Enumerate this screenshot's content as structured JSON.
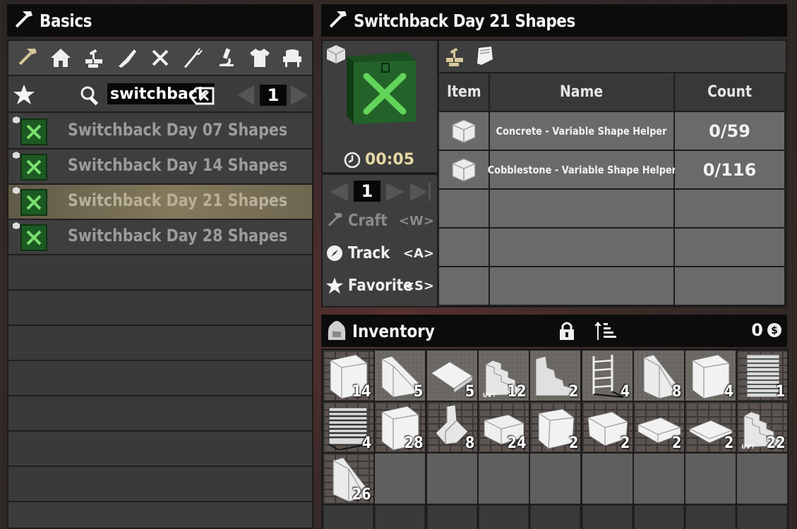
{
  "left_header": {
    "title": "Basics"
  },
  "categories": [
    "hammer-icon",
    "house-icon",
    "blocks-icon",
    "weapon-icon",
    "tools-icon",
    "fork-icon",
    "microscope-icon",
    "shirt-icon",
    "chair-icon"
  ],
  "search": {
    "value": "switchback",
    "page": "1"
  },
  "recipes": [
    {
      "label": "Switchback Day 07 Shapes",
      "selected": false
    },
    {
      "label": "Switchback Day 14 Shapes",
      "selected": false
    },
    {
      "label": "Switchback Day 21 Shapes",
      "selected": true
    },
    {
      "label": "Switchback Day 28 Shapes",
      "selected": false
    }
  ],
  "detail": {
    "title": "Switchback Day 21 Shapes",
    "craft_time": "00:05",
    "quantity": "1",
    "actions": [
      {
        "name": "Craft",
        "key": "<W>",
        "enabled": false
      },
      {
        "name": "Track",
        "key": "<A>",
        "enabled": true
      },
      {
        "name": "Favorite",
        "key": "<S>",
        "enabled": true
      }
    ]
  },
  "ingredients": {
    "headers": {
      "item": "Item",
      "name": "Name",
      "count": "Count"
    },
    "rows": [
      {
        "name": "Concrete - Variable Shape Helper",
        "count": "0/59"
      },
      {
        "name": "Cobblestone - Variable Shape Helper",
        "count": "0/116"
      }
    ]
  },
  "inventory": {
    "title": "Inventory",
    "coins": "0",
    "slots": [
      {
        "shape": "cube",
        "count": "14"
      },
      {
        "shape": "wedge",
        "count": "5"
      },
      {
        "shape": "ramp",
        "count": "5"
      },
      {
        "shape": "stairs",
        "count": "12",
        "uv": true
      },
      {
        "shape": "stairs-tall",
        "count": "2"
      },
      {
        "shape": "ladder",
        "count": "4"
      },
      {
        "shape": "wedge-tall",
        "count": "8"
      },
      {
        "shape": "cube",
        "count": "4"
      },
      {
        "shape": "shutter",
        "count": "1"
      },
      {
        "shape": "shutter-dark",
        "count": "4"
      },
      {
        "shape": "cube",
        "count": "28"
      },
      {
        "shape": "pillar",
        "count": "8"
      },
      {
        "shape": "slab",
        "count": "24"
      },
      {
        "shape": "cube-bevel",
        "count": "2"
      },
      {
        "shape": "slab-bevel",
        "count": "2"
      },
      {
        "shape": "plate",
        "count": "2"
      },
      {
        "shape": "plate-thin",
        "count": "2"
      },
      {
        "shape": "stairs",
        "count": "22",
        "uv": true
      },
      {
        "shape": "wedge-tall",
        "count": "26"
      }
    ],
    "uv_label": "UV↑"
  }
}
